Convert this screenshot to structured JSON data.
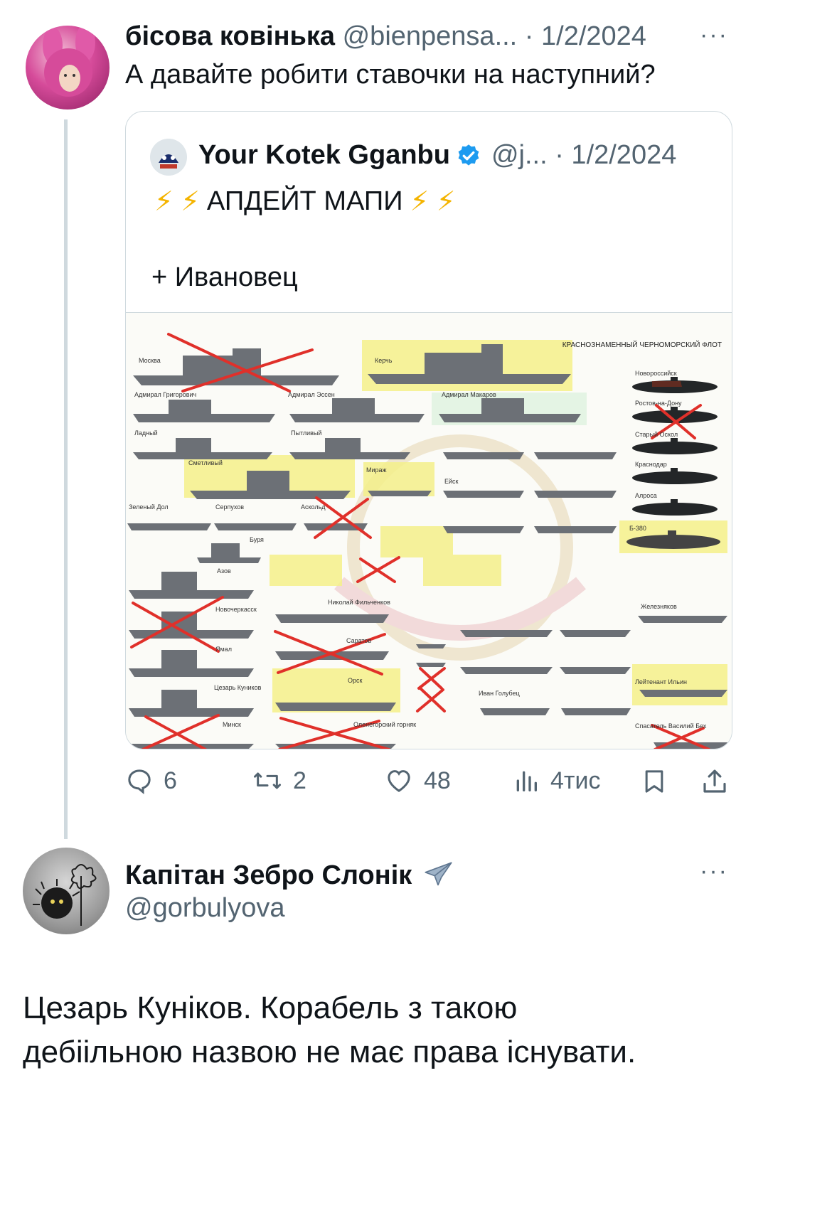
{
  "post": {
    "author_name": "бісова ковінька",
    "handle_date": "@bienpensa... · 1/2/2024",
    "text": "А давайте робити ставочки на наступний?"
  },
  "quoted": {
    "author_name": "Your Kotek Gganbu",
    "handle_date": "@j... · 1/2/2024",
    "headline_emoji_left": "⚡ ⚡",
    "headline": "АПДЕЙТ МАПИ",
    "headline_emoji_right": "⚡ ⚡",
    "subline": "+ Ивановец",
    "image": {
      "title": "КРАСНОЗНАМЕННЫЙ ЧЕРНОМОРСКИЙ ФЛОТ",
      "labels": [
        "Москва",
        "Керчь",
        "Адмирал Григорович",
        "Адмирал Эссен",
        "Адмирал Макаров",
        "Ладный",
        "Пытливый",
        "Сметливый",
        "Мираж",
        "Ейск",
        "Зеленый Дол",
        "Серпухов",
        "Аскольд",
        "Буря",
        "Азов",
        "Новочеркасск",
        "Ямал",
        "Цезарь Куников",
        "Минск",
        "Николай Фильченков",
        "Саратов",
        "Орск",
        "Оленегорский горняк",
        "Иван Голубец",
        "Железняков",
        "Новороссийск",
        "Ростов-на-Дону",
        "Старый Оскол",
        "Краснодар",
        "Алроса",
        "Б-380",
        "Спасатель Василий Бех",
        "Лейтенант Ильин"
      ]
    }
  },
  "actions": {
    "replies": "6",
    "reposts": "2",
    "likes": "48",
    "views": "4тис"
  },
  "reply": {
    "author_name": "Капітан Зебро Слонік",
    "handle": "@gorbulyova",
    "text_line1": "Цезарь Куніков. Корабель з такою",
    "text_line2": "дебіільною назвою не має права існувати."
  },
  "colors": {
    "text": "#0f1419",
    "muted": "#536471",
    "verified": "#1d9bf0",
    "lightning": "#f4b400",
    "highlight": "#f4f08a",
    "cross": "#e0302a",
    "border": "#cfd9de"
  },
  "icons": [
    "reply-icon",
    "repost-icon",
    "like-icon",
    "views-icon",
    "bookmark-icon",
    "share-icon",
    "verified-icon",
    "airplane-icon",
    "more-icon"
  ]
}
